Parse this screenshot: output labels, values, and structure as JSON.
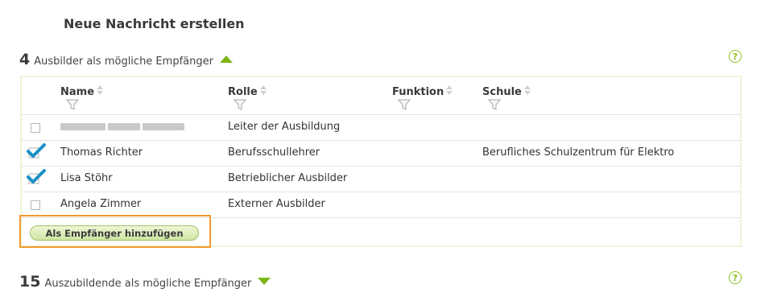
{
  "page_title": "Neue Nachricht erstellen",
  "trainers": {
    "count": "4",
    "label": "Ausbilder als mögliche Empfänger",
    "columns": {
      "name": "Name",
      "role": "Rolle",
      "function": "Funktion",
      "school": "Schule"
    },
    "rows": [
      {
        "name": "",
        "role": "Leiter der Ausbildung",
        "function": "",
        "school": "",
        "checked": false,
        "name_redacted": true
      },
      {
        "name": "Thomas Richter",
        "role": "Berufsschullehrer",
        "function": "",
        "school": "Berufliches Schulzentrum für Elektro",
        "checked": true
      },
      {
        "name": "Lisa Stöhr",
        "role": "Betrieblicher Ausbilder",
        "function": "",
        "school": "",
        "checked": true
      },
      {
        "name": "Angela Zimmer",
        "role": "Externer Ausbilder",
        "function": "",
        "school": "",
        "checked": false
      }
    ],
    "add_button_label": "Als Empfänger hinzufügen"
  },
  "trainees": {
    "count": "15",
    "label": "Auszubildende als mögliche Empfänger"
  },
  "help_glyph": "?",
  "colors": {
    "accent_green": "#8dc21f",
    "checkmark_blue": "#1a8fc6",
    "highlight_orange": "#f29a2f"
  },
  "icons": [
    "triangle-up-icon",
    "triangle-down-icon",
    "help-icon",
    "sort-icon",
    "filter-icon",
    "checkmark-icon"
  ]
}
